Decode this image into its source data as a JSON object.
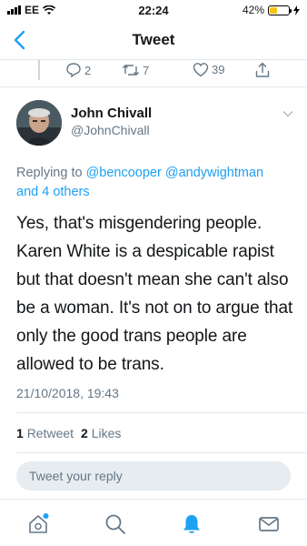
{
  "status_bar": {
    "carrier": "EE",
    "time": "22:24",
    "battery_percent": "42%",
    "battery_level": 0.42
  },
  "nav": {
    "title": "Tweet",
    "back_icon": "chevron-left-icon"
  },
  "previous_tweet_actions": {
    "reply_count": "2",
    "retweet_count": "7",
    "like_count": "39"
  },
  "tweet": {
    "author_name": "John Chivall",
    "author_handle": "@JohnChivall",
    "replying_to_prefix": "Replying to ",
    "replying_to_mentions": "@bencooper @andywightman",
    "replying_to_others": "and 4 others",
    "text": "Yes, that's misgendering people. Karen White is a despicable rapist but that doesn't mean she can't also be a woman. It's not on to argue that only the good trans people are allowed to be trans.",
    "timestamp": "21/10/2018, 19:43",
    "retweet_count": "1",
    "retweet_label": "Retweet",
    "like_count": "2",
    "like_label": "Likes"
  },
  "reply_box": {
    "placeholder": "Tweet your reply"
  },
  "tabbar": {
    "items": [
      "home-icon",
      "search-icon",
      "notifications-icon",
      "messages-icon"
    ]
  },
  "colors": {
    "accent": "#1da1f2",
    "secondary_text": "#657786",
    "battery": "#f5c518"
  }
}
